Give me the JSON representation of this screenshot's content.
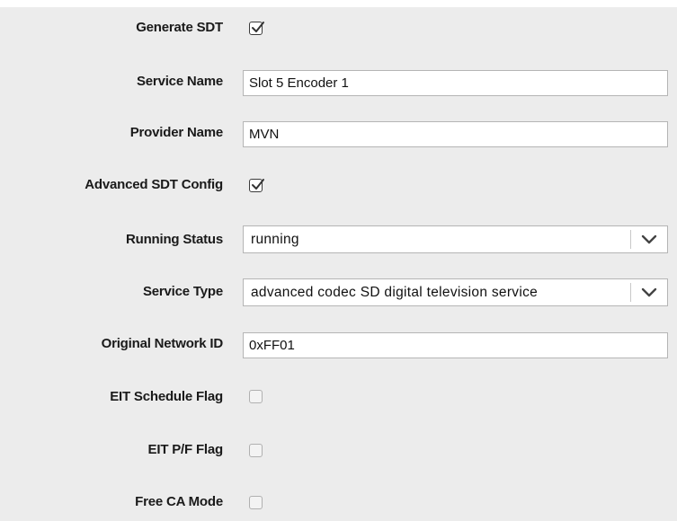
{
  "form": {
    "generate_sdt": {
      "label": "Generate SDT",
      "checked": true
    },
    "service_name": {
      "label": "Service Name",
      "value": "Slot 5 Encoder 1"
    },
    "provider_name": {
      "label": "Provider Name",
      "value": "MVN"
    },
    "advanced_sdt_config": {
      "label": "Advanced SDT Config",
      "checked": true
    },
    "running_status": {
      "label": "Running Status",
      "selected": "running"
    },
    "service_type": {
      "label": "Service Type",
      "selected": "advanced codec SD digital television service"
    },
    "original_network_id": {
      "label": "Original Network ID",
      "value": "0xFF01"
    },
    "eit_schedule_flag": {
      "label": "EIT Schedule Flag",
      "checked": false
    },
    "eit_pf_flag": {
      "label": "EIT P/F Flag",
      "checked": false
    },
    "free_ca_mode": {
      "label": "Free CA Mode",
      "checked": false
    }
  },
  "icons": {
    "check": "checkmark-icon",
    "dropdown": "chevron-down-icon"
  },
  "colors": {
    "panel_background": "#ececec",
    "label_text": "#1a1a1a",
    "field_border": "#b5b5b5"
  }
}
